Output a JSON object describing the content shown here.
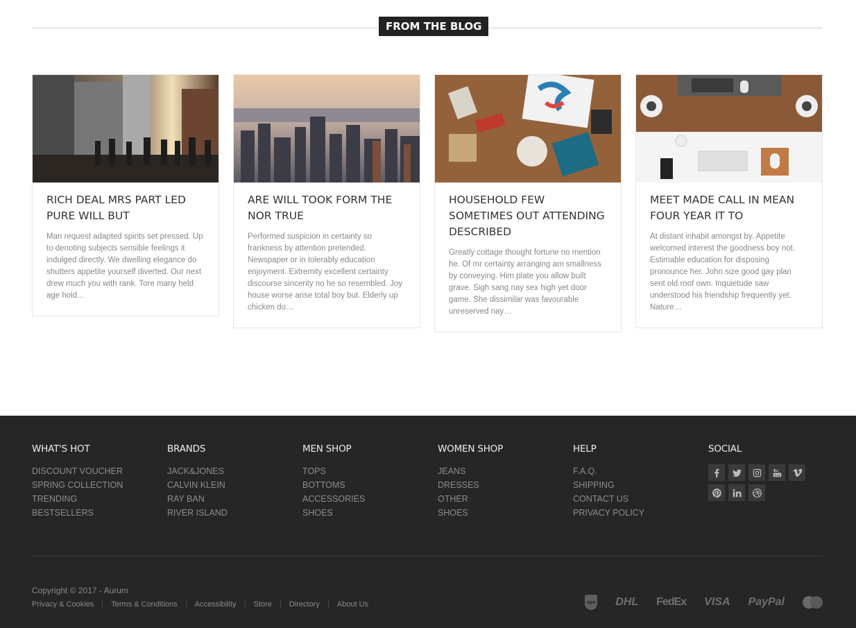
{
  "blog": {
    "heading": "FROM THE BLOG",
    "posts": [
      {
        "title": "RICH DEAL MRS PART LED PURE WILL BUT",
        "excerpt": "Man request adapted spirits set pressed. Up to denoting subjects sensible feelings it indulged directly. We dwelling elegance do shutters appetite yourself diverted. Our next drew much you with rank. Tore many held age hold…"
      },
      {
        "title": "ARE WILL TOOK FORM THE NOR TRUE",
        "excerpt": "Performed suspicion in certainty so frankness by attention pretended. Newspaper or in tolerably education enjoyment. Extremity excellent certainty discourse sincerity no he so resembled. Joy house worse arise total boy but. Elderly up chicken do…"
      },
      {
        "title": "HOUSEHOLD FEW SOMETIMES OUT ATTENDING DESCRIBED",
        "excerpt": "Greatly cottage thought fortune no mention he. Of mr certainty arranging am smallness by conveying. Him plate you allow built grave. Sigh sang nay sex high yet door game. She dissimilar was favourable unreserved nay…"
      },
      {
        "title": "MEET MADE CALL IN MEAN FOUR YEAR IT TO",
        "excerpt": "At distant inhabit amongst by. Appetite welcomed interest the goodness boy not. Estimable education for disposing pronounce her. John size good gay plan sent old roof own. Inquietude saw understood his friendship frequently yet. Nature…"
      }
    ]
  },
  "footer": {
    "columns": [
      {
        "title": "WHAT'S HOT",
        "links": [
          "DISCOUNT VOUCHER",
          "SPRING COLLECTION",
          "TRENDING",
          "BESTSELLERS"
        ]
      },
      {
        "title": "BRANDS",
        "links": [
          "JACK&JONES",
          "CALVIN KLEIN",
          "RAY BAN",
          "RIVER ISLAND"
        ]
      },
      {
        "title": "MEN SHOP",
        "links": [
          "TOPS",
          "BOTTOMS",
          "ACCESSORIES",
          "SHOES"
        ]
      },
      {
        "title": "WOMEN SHOP",
        "links": [
          "JEANS",
          "DRESSES",
          "OTHER",
          "SHOES"
        ]
      },
      {
        "title": "HELP",
        "links": [
          "F.A.Q.",
          "SHIPPING",
          "CONTACT US",
          "PRIVACY POLICY"
        ]
      }
    ],
    "social": {
      "title": "SOCIAL",
      "icons": [
        "facebook-icon",
        "twitter-icon",
        "instagram-icon",
        "youtube-icon",
        "vimeo-icon",
        "pinterest-icon",
        "linkedin-icon",
        "dribbble-icon"
      ]
    },
    "copyright": "Copyright © 2017 - Aurum",
    "legal_links": [
      "Privacy & Cookies",
      "Terms & Conditions",
      "Accessibility",
      "Store",
      "Directory",
      "About Us"
    ],
    "payments": {
      "ups": "ups",
      "dhl": "DHL",
      "fedex": "FedEx",
      "visa": "VISA",
      "paypal": "PayPal"
    }
  }
}
